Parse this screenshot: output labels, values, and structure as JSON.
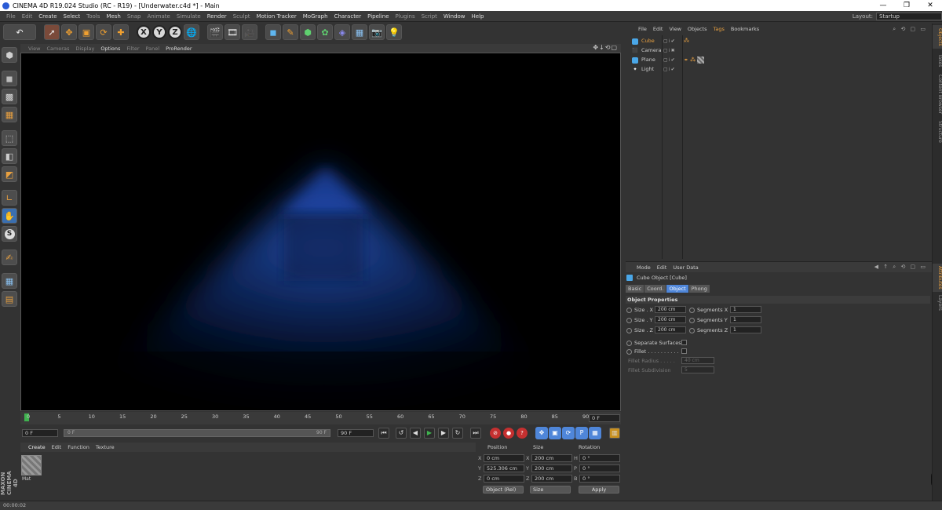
{
  "window": {
    "title": "CINEMA 4D R19.024 Studio (RC - R19) - [Underwater.c4d *] - Main",
    "controls": [
      "—",
      "❐",
      "✕"
    ]
  },
  "menubar": {
    "items": [
      "File",
      "Edit",
      "Create",
      "Select",
      "Tools",
      "Mesh",
      "Snap",
      "Animate",
      "Simulate",
      "Render",
      "Sculpt",
      "Motion Tracker",
      "MoGraph",
      "Character",
      "Pipeline",
      "Plugins",
      "Script",
      "Window",
      "Help"
    ],
    "layout_label": "Layout:",
    "layout_value": "Startup"
  },
  "viewport": {
    "menu": [
      "View",
      "Cameras",
      "Display",
      "Options",
      "Filter",
      "Panel",
      "ProRender"
    ],
    "nav_icons": "✥↓⟲▢"
  },
  "timeline": {
    "ticks": [
      "0",
      "5",
      "10",
      "15",
      "20",
      "25",
      "30",
      "35",
      "40",
      "45",
      "50",
      "55",
      "60",
      "65",
      "70",
      "75",
      "80",
      "85",
      "90"
    ],
    "current_frame": "0 F"
  },
  "transport": {
    "start_field": "0 F",
    "range_start": "0 F",
    "range_end": "90 F",
    "end_field": "90 F"
  },
  "material_manager": {
    "menu": [
      "Create",
      "Edit",
      "Function",
      "Texture"
    ],
    "material_name": "Mat"
  },
  "brand": {
    "logo_text": "MAXON CINEMA 4D"
  },
  "coordinates": {
    "headers": [
      "Position",
      "Size",
      "Rotation"
    ],
    "rows": [
      {
        "axis": "X",
        "position": "0 cm",
        "size_axis": "X",
        "size": "200 cm",
        "rot_axis": "H",
        "rotation": "0 °"
      },
      {
        "axis": "Y",
        "position": "525.306 cm",
        "size_axis": "Y",
        "size": "200 cm",
        "rot_axis": "P",
        "rotation": "0 °"
      },
      {
        "axis": "Z",
        "position": "0 cm",
        "size_axis": "Z",
        "size": "200 cm",
        "rot_axis": "B",
        "rotation": "0 °"
      }
    ],
    "mode_select": "Object (Rel)",
    "size_select": "Size",
    "apply_label": "Apply"
  },
  "statusbar": {
    "text": "00:00:02"
  },
  "object_manager": {
    "menu": [
      "File",
      "Edit",
      "View",
      "Objects",
      "Tags",
      "Bookmarks"
    ],
    "objects": [
      {
        "name": "Cube",
        "selected": true
      },
      {
        "name": "Camera",
        "selected": false
      },
      {
        "name": "Plane",
        "selected": false
      },
      {
        "name": "Light",
        "selected": false
      }
    ]
  },
  "right_tabs": {
    "top": [
      "Objects",
      "Takes",
      "Content Browser",
      "Structure"
    ],
    "bottom": [
      "Attributes",
      "Layers"
    ]
  },
  "attributes": {
    "menu": [
      "Mode",
      "Edit",
      "User Data"
    ],
    "title": "Cube Object [Cube]",
    "tabs": [
      "Basic",
      "Coord.",
      "Object",
      "Phong"
    ],
    "active_tab": "Object",
    "section": "Object Properties",
    "size_x_label": "Size . X",
    "size_x": "200 cm",
    "size_y_label": "Size . Y",
    "size_y": "200 cm",
    "size_z_label": "Size . Z",
    "size_z": "200 cm",
    "seg_x_label": "Segments X",
    "seg_x": "1",
    "seg_y_label": "Segments Y",
    "seg_y": "1",
    "seg_z_label": "Segments Z",
    "seg_z": "1",
    "separate_label": "Separate Surfaces",
    "fillet_label": "Fillet . . . . . . . . . .",
    "fillet_radius_label": "Fillet Radius . . . . .",
    "fillet_radius": "40 cm",
    "fillet_sub_label": "Fillet Subdivision",
    "fillet_sub": "5"
  }
}
